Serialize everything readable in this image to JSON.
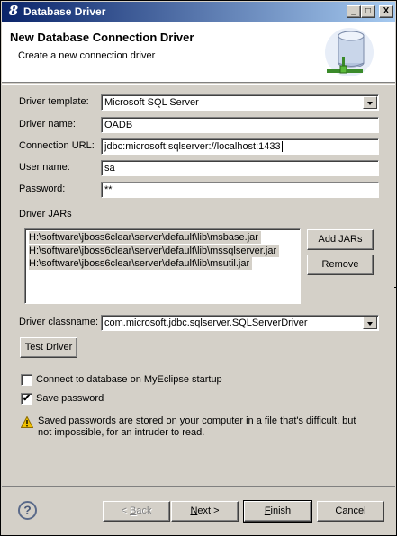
{
  "window": {
    "title": "Database Driver",
    "app_icon_glyph": "8",
    "minimize_glyph": "_",
    "maximize_glyph": "□",
    "close_glyph": "X"
  },
  "header": {
    "title": "New Database Connection Driver",
    "description": "Create a new connection driver",
    "icon": "database-driver-icon"
  },
  "form": {
    "driver_template": {
      "label": "Driver template:",
      "value": "Microsoft SQL Server"
    },
    "driver_name": {
      "label": "Driver name:",
      "value": "OADB"
    },
    "connection_url": {
      "label": "Connection URL:",
      "value": "jdbc:microsoft:sqlserver://localhost:1433"
    },
    "user_name": {
      "label": "User name:",
      "value": "sa"
    },
    "password": {
      "label": "Password:",
      "value": "**"
    }
  },
  "jars": {
    "label": "Driver JARs",
    "items": [
      "H:\\software\\jboss6clear\\server\\default\\lib\\msbase.jar",
      "H:\\software\\jboss6clear\\server\\default\\lib\\mssqlserver.jar",
      "H:\\software\\jboss6clear\\server\\default\\lib\\msutil.jar"
    ],
    "add_button": "Add JARs",
    "remove_button": "Remove"
  },
  "classname": {
    "label": "Driver classname:",
    "value": "com.microsoft.jdbc.sqlserver.SQLServerDriver"
  },
  "test_button": "Test Driver",
  "options": {
    "connect_startup": {
      "label": "Connect to database on MyEclipse startup",
      "checked": false
    },
    "save_password": {
      "label": "Save password",
      "checked": true,
      "check_glyph": "✔"
    }
  },
  "warning": "Saved passwords are stored on your computer in a file that's difficult, but not impossible, for an intruder to read.",
  "footer": {
    "help_glyph": "?",
    "back": {
      "pre": "< ",
      "mnemonic": "B",
      "post": "ack",
      "enabled": false
    },
    "next": {
      "pre": "",
      "mnemonic": "N",
      "post": "ext >"
    },
    "finish": {
      "pre": "",
      "mnemonic": "F",
      "post": "inish"
    },
    "cancel": "Cancel"
  },
  "colors": {
    "titlebar_start": "#0a246a",
    "titlebar_end": "#a6caf0",
    "dialog_face": "#d4d0c8",
    "warning": "#f0c000"
  }
}
